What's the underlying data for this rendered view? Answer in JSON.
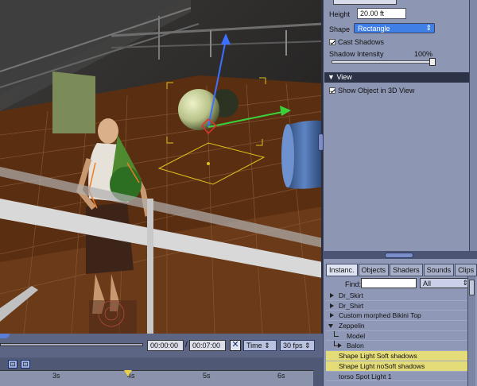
{
  "properties": {
    "height_label": "Height",
    "height_value": "20.00 ft",
    "shape_label": "Shape",
    "shape_value": "Rectangle",
    "cast_shadows_label": "Cast Shadows",
    "shadow_intensity_label": "Shadow Intensity",
    "shadow_intensity_value": "100%",
    "view_section_label": "View",
    "show_object_label": "Show Object in 3D View"
  },
  "library": {
    "tabs": [
      "Instanc.",
      "Objects",
      "Shaders",
      "Sounds",
      "Clips"
    ],
    "find_label": "Find:",
    "find_value": "",
    "filter_value": "All",
    "items": [
      {
        "label": "Dr_Skirt",
        "kind": "collapsed",
        "indent": 0,
        "highlight": false
      },
      {
        "label": "Dr_Shirt",
        "kind": "collapsed",
        "indent": 0,
        "highlight": false
      },
      {
        "label": "Custom morphed Bikini Top",
        "kind": "collapsed",
        "indent": 0,
        "highlight": false
      },
      {
        "label": "Zeppelin",
        "kind": "expanded",
        "indent": 0,
        "highlight": false
      },
      {
        "label": "Model",
        "kind": "child",
        "indent": 1,
        "highlight": false
      },
      {
        "label": "Balon",
        "kind": "child-collapsed",
        "indent": 1,
        "highlight": false
      },
      {
        "label": "Shape Light Soft shadows",
        "kind": "leaf",
        "indent": 0,
        "highlight": true
      },
      {
        "label": "Shape Light noSoft shadows",
        "kind": "leaf",
        "indent": 0,
        "highlight": true
      },
      {
        "label": "torso Spot Light 1",
        "kind": "leaf",
        "indent": 0,
        "highlight": false
      }
    ]
  },
  "timeline": {
    "current_time": "00:00:00",
    "separator": "/",
    "total_time": "00:07:00",
    "mode_value": "Time",
    "fps_value": "30 fps",
    "ruler_labels": [
      "3s",
      "4s",
      "5s",
      "6s"
    ]
  },
  "colors": {
    "highlight": "#e3dc78",
    "panel": "#8d96b2",
    "accent": "#2c3347"
  }
}
